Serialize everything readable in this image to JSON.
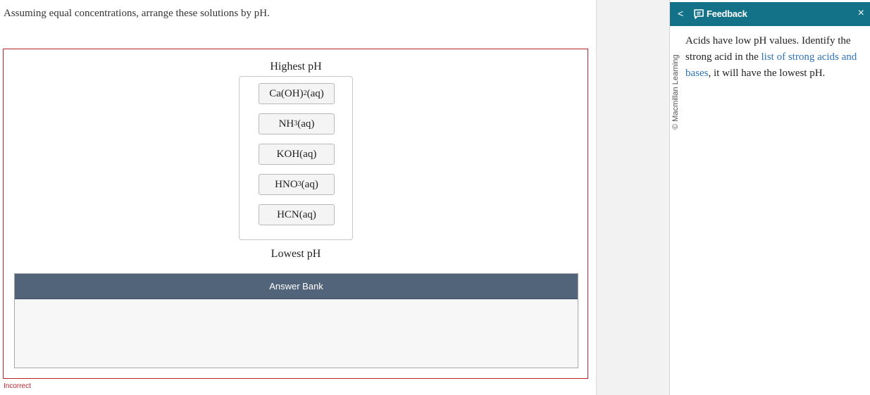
{
  "question": "Assuming equal concentrations, arrange these solutions by pH.",
  "ranking": {
    "top_label": "Highest pH",
    "bottom_label": "Lowest pH",
    "items": [
      {
        "pre": "Ca(OH)",
        "sub": "2",
        "post": "(aq)"
      },
      {
        "pre": "NH",
        "sub": "3",
        "post": "(aq)"
      },
      {
        "pre": "KOH(aq)",
        "sub": "",
        "post": ""
      },
      {
        "pre": "HNO",
        "sub": "3",
        "post": "(aq)"
      },
      {
        "pre": "HCN(aq)",
        "sub": "",
        "post": ""
      }
    ]
  },
  "answer_bank": {
    "title": "Answer Bank"
  },
  "status": {
    "text": "Incorrect",
    "color": "#b5272d"
  },
  "feedback": {
    "title": "Feedback",
    "back_glyph": "<",
    "close_glyph": "×",
    "copyright": "© Macmillan Learning",
    "text_before": "Acids have low pH values. Identify the strong acid in the ",
    "link_text": "list of strong acids and bases",
    "text_after": ", it will have the lowest pH.",
    "header_color": "#137287",
    "link_color": "#2f73b7"
  }
}
